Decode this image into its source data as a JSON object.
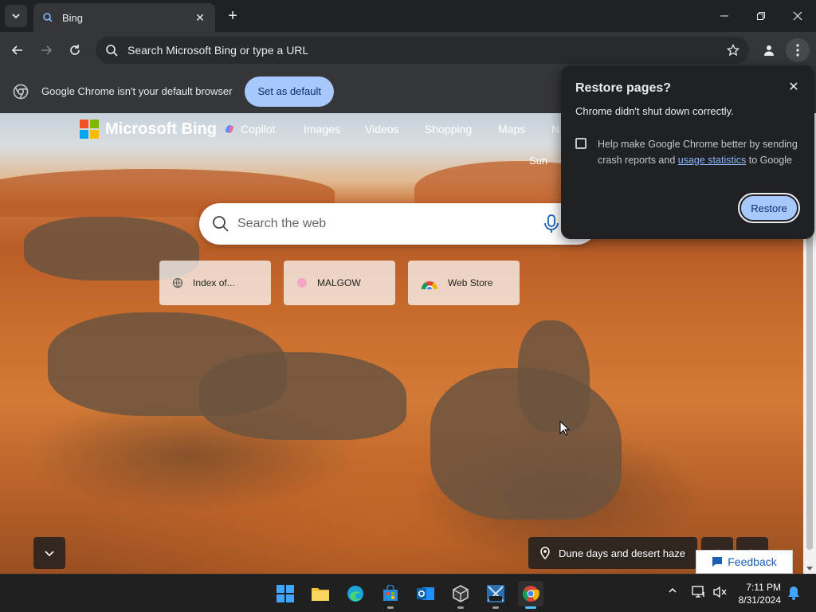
{
  "browser": {
    "tab": {
      "title": "Bing"
    },
    "omnibox": {
      "placeholder": "Search Microsoft Bing or type a URL"
    },
    "infobar": {
      "message": "Google Chrome isn't your default browser",
      "button": "Set as default"
    }
  },
  "bing": {
    "logo_text": "Microsoft Bing",
    "nav": [
      "Copilot",
      "Images",
      "Videos",
      "Shopping",
      "Maps",
      "N"
    ],
    "partial_text": "Sun",
    "search_placeholder": "Search the web",
    "tiles": [
      {
        "label": "Index of..."
      },
      {
        "label": "MALGOW"
      },
      {
        "label": "Web Store"
      }
    ],
    "caption": "Dune days and desert haze",
    "feedback": "Feedback"
  },
  "popup": {
    "title": "Restore pages?",
    "subtitle": "Chrome didn't shut down correctly.",
    "checkbox_text_before": "Help make Google Chrome better by sending crash reports and",
    "checkbox_link": "usage statistics",
    "checkbox_text_after": "to Google",
    "restore_button": "Restore"
  },
  "taskbar": {
    "time": "7:11 PM",
    "date": "8/31/2024"
  },
  "colors": {
    "accent": "#a8c7fa",
    "chrome_dark": "#202124",
    "toolbar": "#35363a"
  }
}
